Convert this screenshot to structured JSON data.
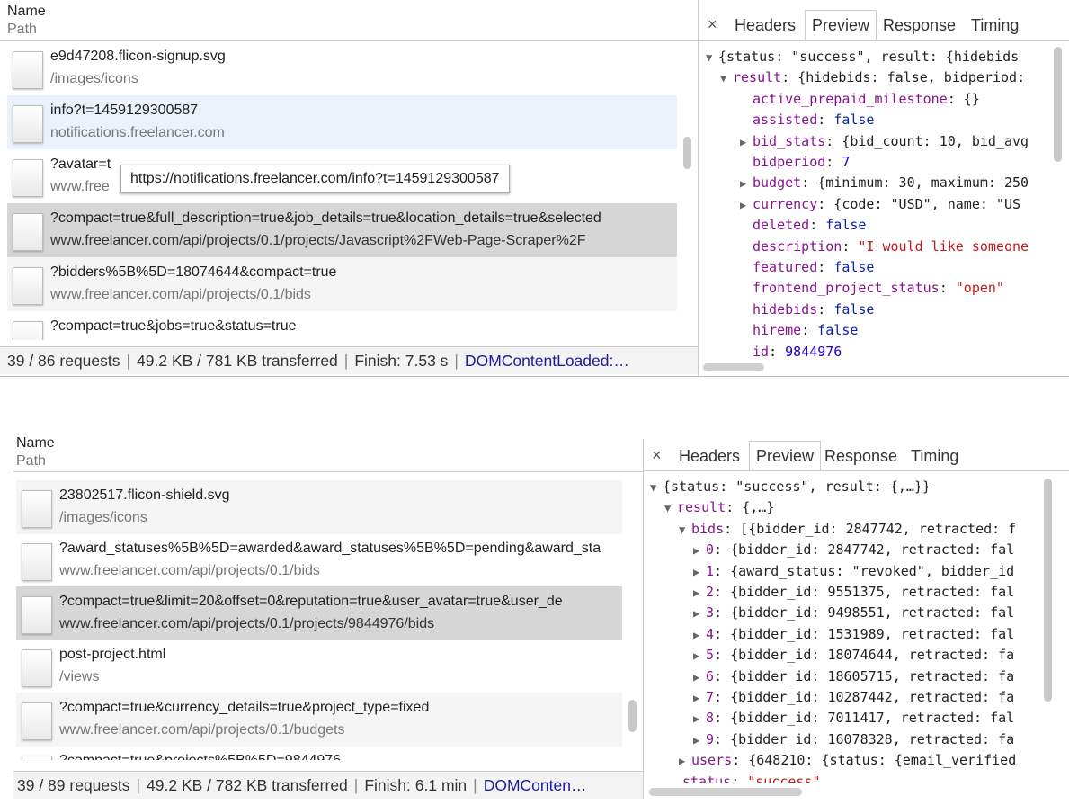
{
  "top": {
    "header": {
      "name": "Name",
      "path": "Path"
    },
    "rows": [
      {
        "name": "e9d47208.flicon-signup.svg",
        "path": "/images/icons"
      },
      {
        "name": "info?t=1459129300587",
        "path": "notifications.freelancer.com"
      },
      {
        "name": "?avatar=t",
        "path": "www.free"
      },
      {
        "name": "?compact=true&full_description=true&job_details=true&location_details=true&selected",
        "path": "www.freelancer.com/api/projects/0.1/projects/Javascript%2FWeb-Page-Scraper%2F"
      },
      {
        "name": "?bidders%5B%5D=18074644&compact=true",
        "path": "www.freelancer.com/api/projects/0.1/bids"
      },
      {
        "name": "?compact=true&jobs=true&status=true",
        "path": ""
      }
    ],
    "tooltip": "https://notifications.freelancer.com/info?t=1459129300587",
    "status": {
      "requests": "39 / 86 requests",
      "size": "49.2 KB / 781 KB transferred",
      "finish": "Finish: 7.53 s",
      "dom": "DOMContentLoaded:…"
    },
    "tabs": {
      "close": "×",
      "headers": "Headers",
      "preview": "Preview",
      "response": "Response",
      "timing": "Timing"
    },
    "preview": [
      {
        "tri": "▼",
        "text": "{status: \"success\", result: {hidebids"
      },
      {
        "tri": "▼",
        "key": "result",
        "text": ": {hidebids: false, bidperiod:"
      },
      {
        "key": "active_prepaid_milestone",
        "text": ": {}"
      },
      {
        "key": "assisted",
        "text": ": ",
        "val": "false",
        "vt": "b"
      },
      {
        "tri": "▶",
        "key": "bid_stats",
        "text": ": {bid_count: 10, bid_avg"
      },
      {
        "key": "bidperiod",
        "text": ": ",
        "val": "7",
        "vt": "n"
      },
      {
        "tri": "▶",
        "key": "budget",
        "text": ": {minimum: 30, maximum: 250"
      },
      {
        "tri": "▶",
        "key": "currency",
        "text": ": {code: \"USD\", name: \"US"
      },
      {
        "key": "deleted",
        "text": ": ",
        "val": "false",
        "vt": "b"
      },
      {
        "key": "description",
        "text": ": ",
        "val": "\"I would like someone",
        "vt": "s"
      },
      {
        "key": "featured",
        "text": ": ",
        "val": "false",
        "vt": "b"
      },
      {
        "key": "frontend_project_status",
        "text": ": ",
        "val": "\"open\"",
        "vt": "s"
      },
      {
        "key": "hidebids",
        "text": ": ",
        "val": "false",
        "vt": "b"
      },
      {
        "key": "hireme",
        "text": ": ",
        "val": "false",
        "vt": "b"
      },
      {
        "key": "id",
        "text": ": ",
        "val": "9844976",
        "vt": "n"
      }
    ]
  },
  "bottom": {
    "header": {
      "name": "Name",
      "path": "Path"
    },
    "rows": [
      {
        "name": "23802517.flicon-shield.svg",
        "path": "/images/icons"
      },
      {
        "name": "?award_statuses%5B%5D=awarded&award_statuses%5B%5D=pending&award_sta",
        "path": "www.freelancer.com/api/projects/0.1/bids"
      },
      {
        "name": "?compact=true&limit=20&offset=0&reputation=true&user_avatar=true&user_de",
        "path": "www.freelancer.com/api/projects/0.1/projects/9844976/bids"
      },
      {
        "name": "post-project.html",
        "path": "/views"
      },
      {
        "name": "?compact=true&currency_details=true&project_type=fixed",
        "path": "www.freelancer.com/api/projects/0.1/budgets"
      },
      {
        "name": "?compact=true&projects%5B%5D=9844976",
        "path": ""
      }
    ],
    "status": {
      "requests": "39 / 89 requests",
      "size": "49.2 KB / 782 KB transferred",
      "finish": "Finish: 6.1 min",
      "dom": "DOMConten…"
    },
    "tabs": {
      "close": "×",
      "headers": "Headers",
      "preview": "Preview",
      "response": "Response",
      "timing": "Timing"
    },
    "preview": [
      {
        "tri": "▼",
        "text": "{status: \"success\", result: {,…}}"
      },
      {
        "tri": "▼",
        "key": "result",
        "text": ": {,…}"
      },
      {
        "tri": "▼",
        "key": "bids",
        "text": ": [{bidder_id: 2847742, retracted: f"
      },
      {
        "tri": "▶",
        "key": "0",
        "text": ": {bidder_id: 2847742, retracted: fal"
      },
      {
        "tri": "▶",
        "key": "1",
        "text": ": {award_status: \"revoked\", bidder_id"
      },
      {
        "tri": "▶",
        "key": "2",
        "text": ": {bidder_id: 9551375, retracted: fal"
      },
      {
        "tri": "▶",
        "key": "3",
        "text": ": {bidder_id: 9498551, retracted: fal"
      },
      {
        "tri": "▶",
        "key": "4",
        "text": ": {bidder_id: 1531989, retracted: fal"
      },
      {
        "tri": "▶",
        "key": "5",
        "text": ": {bidder_id: 18074644, retracted: fa"
      },
      {
        "tri": "▶",
        "key": "6",
        "text": ": {bidder_id: 18605715, retracted: fa"
      },
      {
        "tri": "▶",
        "key": "7",
        "text": ": {bidder_id: 10287442, retracted: fa"
      },
      {
        "tri": "▶",
        "key": "8",
        "text": ": {bidder_id: 7011417, retracted: fal"
      },
      {
        "tri": "▶",
        "key": "9",
        "text": ": {bidder_id: 16078328, retracted: fa"
      },
      {
        "tri": "▶",
        "key": "users",
        "text": ": {648210: {status: {email_verified"
      },
      {
        "key": "status",
        "text": ": ",
        "val": "\"success\"",
        "vt": "s"
      }
    ]
  }
}
